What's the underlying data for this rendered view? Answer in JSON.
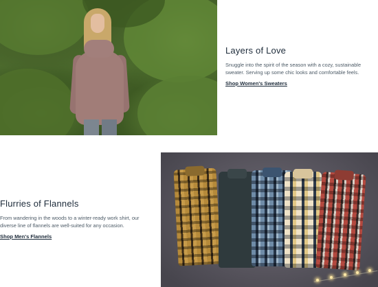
{
  "sections": [
    {
      "heading": "Layers of Love",
      "description": "Snuggle into the spirit of the season with a cozy, sustainable sweater. Serving up some chic looks and comfortable feels.",
      "link": "Shop Women's Sweaters"
    },
    {
      "heading": "Flurries of Flannels",
      "description": "From wandering in the woods to a winter-ready work shirt, our diverse line of flannels are well-suited for any occasion.",
      "link": "Shop Men's Flannels"
    }
  ]
}
